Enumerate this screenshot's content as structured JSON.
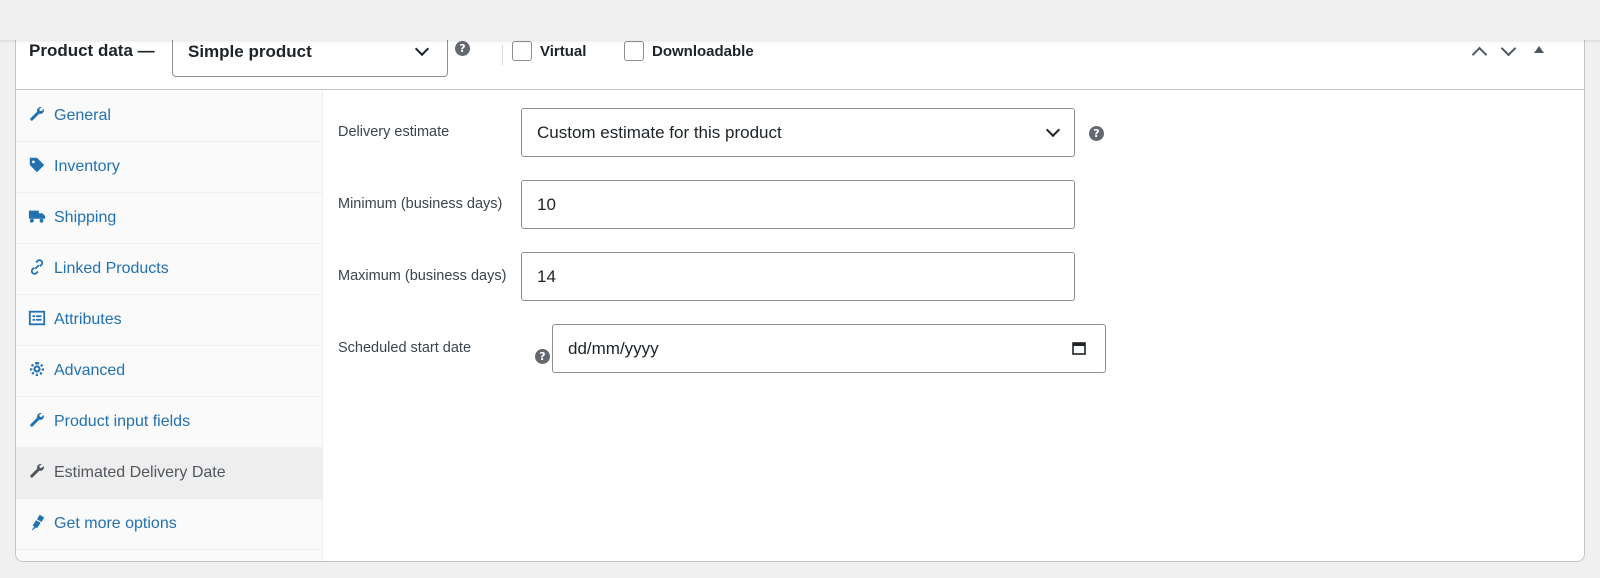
{
  "header": {
    "title": "Product data —",
    "product_type": "Simple product",
    "virtual_label": "Virtual",
    "downloadable_label": "Downloadable",
    "help_glyph": "?"
  },
  "tabs": [
    {
      "label": "General",
      "icon": "wrench-icon",
      "active": false
    },
    {
      "label": "Inventory",
      "icon": "tag-icon",
      "active": false
    },
    {
      "label": "Shipping",
      "icon": "truck-icon",
      "active": false
    },
    {
      "label": "Linked Products",
      "icon": "link-icon",
      "active": false
    },
    {
      "label": "Attributes",
      "icon": "list-icon",
      "active": false
    },
    {
      "label": "Advanced",
      "icon": "gear-icon",
      "active": false
    },
    {
      "label": "Product input fields",
      "icon": "wrench-icon",
      "active": false
    },
    {
      "label": "Estimated Delivery Date",
      "icon": "wrench-icon",
      "active": true
    },
    {
      "label": "Get more options",
      "icon": "plugin-icon",
      "active": false
    }
  ],
  "form": {
    "delivery_estimate": {
      "label": "Delivery estimate",
      "value": "Custom estimate for this product"
    },
    "minimum": {
      "label": "Minimum (business days)",
      "value": "10"
    },
    "maximum": {
      "label": "Maximum (business days)",
      "value": "14"
    },
    "start_date": {
      "label": "Scheduled start date",
      "placeholder": "dd/mm/yyyy"
    }
  },
  "colors": {
    "link": "#2271b1",
    "active_tab_bg": "#eeeeee",
    "border": "#8c8f94"
  }
}
